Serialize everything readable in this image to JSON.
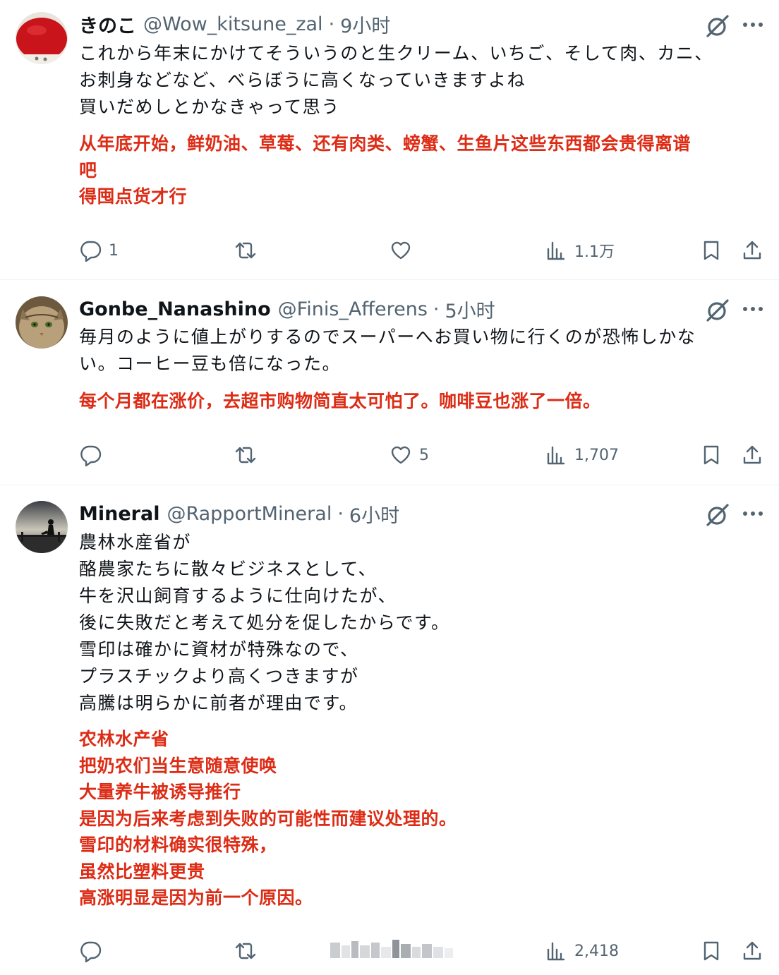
{
  "posts": [
    {
      "name": "きのこ",
      "handle": "@Wow_kitsune_zal",
      "sep": "·",
      "time": "9小时",
      "jp_lines": [
        "これから年末にかけてそういうのと生クリーム、いちご、そして肉、カニ、",
        "お刺身などなど、べらぼうに高くなっていきますよね",
        "買いだめしとかなきゃって思う"
      ],
      "cn_lines": [
        "从年底开始，鲜奶油、草莓、还有肉类、螃蟹、生鱼片这些东西都会贵得离谱",
        "吧",
        "得囤点货才行"
      ],
      "reply_count": "1",
      "retweet_count": "",
      "like_count": "",
      "view_count": "1.1万"
    },
    {
      "name": "Gonbe_Nanashino",
      "handle": "@Finis_Afferens",
      "sep": "·",
      "time": "5小时",
      "jp_lines": [
        "毎月のように値上がりするのでスーパーへお買い物に行くのが恐怖しかな",
        "い。コーヒー豆も倍になった。"
      ],
      "cn_lines": [
        "每个月都在涨价，去超市购物简直太可怕了。咖啡豆也涨了一倍。"
      ],
      "reply_count": "",
      "retweet_count": "",
      "like_count": "5",
      "view_count": "1,707"
    },
    {
      "name": "Mineral",
      "handle": "@RapportMineral",
      "sep": "·",
      "time": "6小时",
      "jp_lines": [
        "農林水産省が",
        "酪農家たちに散々ビジネスとして、",
        "牛を沢山飼育するように仕向けたが、",
        "後に失敗だと考えて処分を促したからです。",
        "雪印は確かに資材が特殊なので、",
        "プラスチックより高くつきますが",
        "高騰は明らかに前者が理由です。"
      ],
      "cn_lines": [
        "农林水产省",
        "把奶农们当生意随意使唤",
        "大量养牛被诱导推行",
        "是因为后来考虑到失败的可能性而建议处理的。",
        "雪印的材料确实很特殊，",
        "虽然比塑料更贵",
        "高涨明显是因为前一个原因。"
      ],
      "reply_count": "",
      "retweet_count": "",
      "like_count": "",
      "view_count": "2,418"
    }
  ],
  "icons": {
    "reply": "reply-icon",
    "retweet": "retweet-icon",
    "like": "heart-icon",
    "views": "views-icon",
    "bookmark": "bookmark-icon",
    "share": "share-icon",
    "grok": "grok-icon",
    "more": "more-icon"
  },
  "colors": {
    "translation": "#dd2c16",
    "secondary_text": "#536471",
    "divider": "#eff3f4"
  }
}
